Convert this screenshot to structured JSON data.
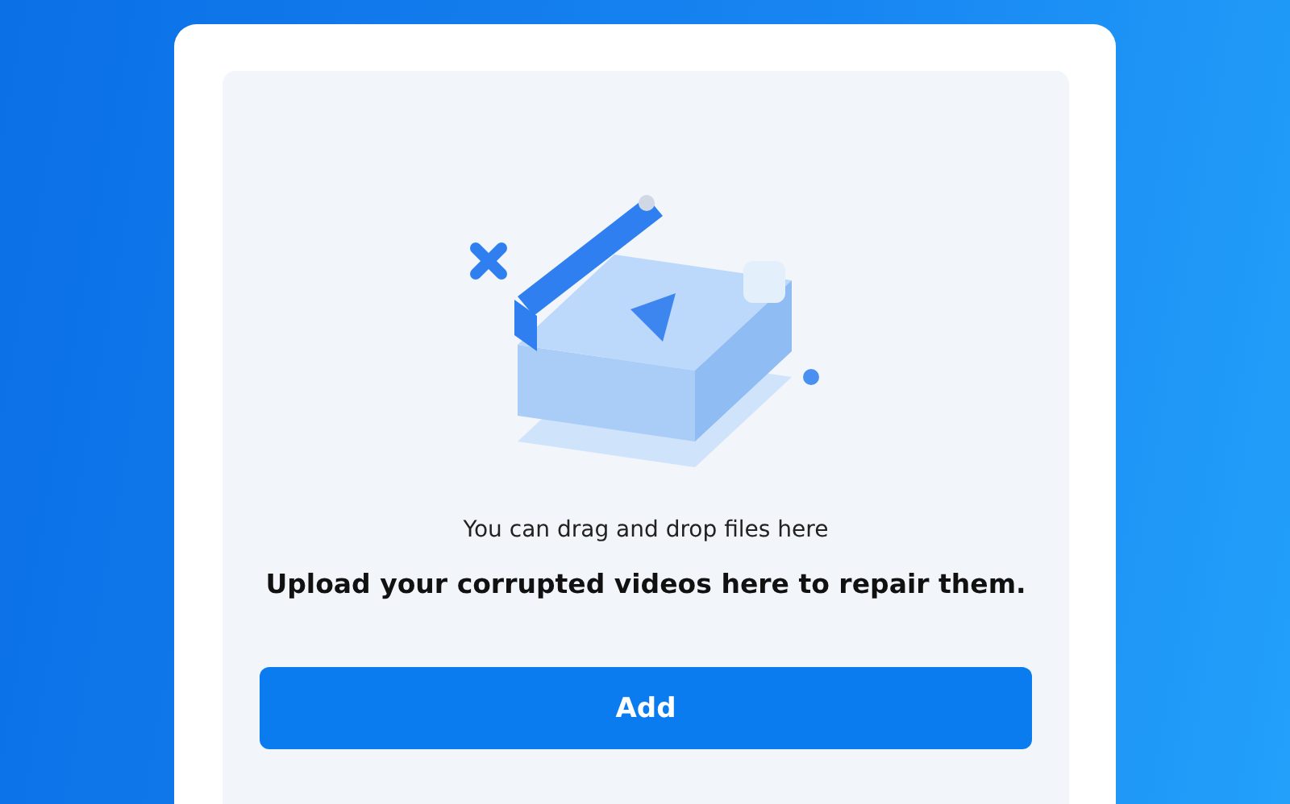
{
  "upload_panel": {
    "drop_hint": "You can drag and drop files here",
    "heading": "Upload your corrupted videos here to repair them.",
    "add_button": {
      "label": "Add"
    }
  }
}
